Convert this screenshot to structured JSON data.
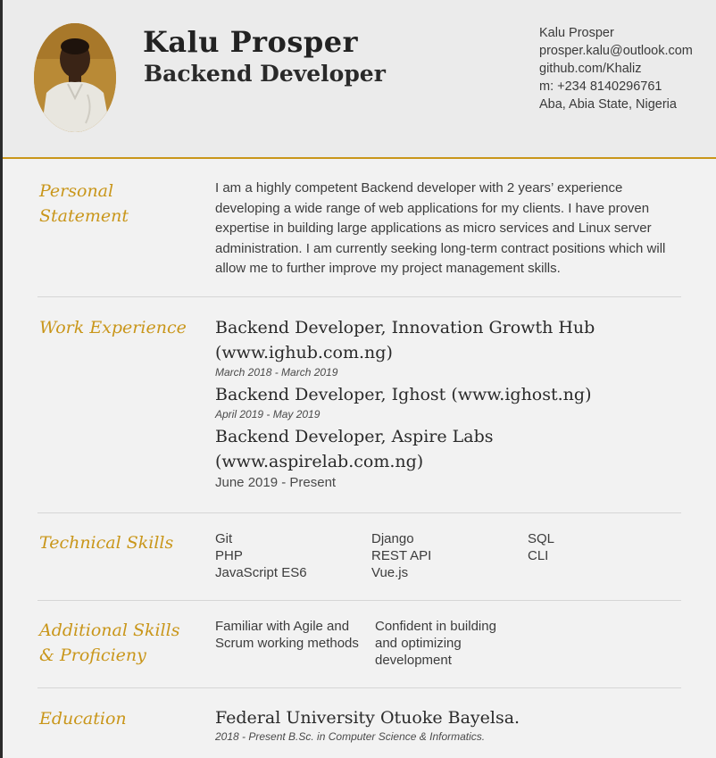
{
  "header": {
    "name": "Kalu Prosper",
    "title": "Backend Developer",
    "contact": {
      "name": "Kalu Prosper",
      "email": "prosper.kalu@outlook.com",
      "github": "github.com/Khaliz",
      "phone": "m: +234 8140296761",
      "location": "Aba, Abia State, Nigeria"
    }
  },
  "personal_statement": {
    "title_line1": "Personal",
    "title_line2": "Statement",
    "text": "I am a highly competent Backend developer with 2 years’ experience developing a wide range of web applications for my clients. I have proven expertise in building large applications as micro services and Linux server administration. I am currently seeking long-term contract positions which will allow me to further improve my project management skills."
  },
  "work_experience": {
    "title": "Work Experience",
    "jobs": [
      {
        "role": "Backend Developer, Innovation Growth Hub (www.ighub.com.ng)",
        "dates": "March 2018 - March 2019"
      },
      {
        "role": "Backend Developer, Ighost (www.ighost.ng)",
        "dates": "April 2019 - May 2019"
      },
      {
        "role": "Backend Developer, Aspire Labs (www.aspirelab.com.ng)",
        "dates": "June 2019 - Present"
      }
    ]
  },
  "technical_skills": {
    "title": "Technical Skills",
    "columns": [
      [
        "Git",
        "PHP",
        "JavaScript ES6"
      ],
      [
        "Django",
        "REST API",
        "Vue.js"
      ],
      [
        "SQL",
        "CLI"
      ]
    ]
  },
  "additional_skills": {
    "title_line1": "Additional Skills",
    "title_line2": "& Proficieny",
    "items": [
      "Familiar with Agile and Scrum working methods",
      "Confident in building and optimizing development"
    ]
  },
  "education": {
    "title": "Education",
    "school": "Federal University Otuoke Bayelsa.",
    "detail": "2018 - Present B.Sc. in Computer Science & Informatics."
  },
  "colors": {
    "accent": "#c9961a",
    "header_bg": "#ebebeb",
    "page_bg": "#f2f2f2"
  }
}
